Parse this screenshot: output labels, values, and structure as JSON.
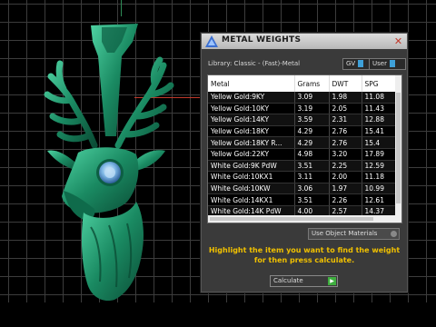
{
  "panel": {
    "title": "METAL WEIGHTS",
    "library_label": "Library: Classic - (Fast)-Metal",
    "gv_label": "GV",
    "user_label": "User",
    "close_icon": "close-icon"
  },
  "table": {
    "headers": [
      "Metal",
      "Grams",
      "DWT",
      "SPG"
    ],
    "rows": [
      [
        "Yellow Gold:9KY",
        "3.09",
        "1.98",
        "11.08"
      ],
      [
        "Yellow Gold:10KY",
        "3.19",
        "2.05",
        "11.43"
      ],
      [
        "Yellow Gold:14KY",
        "3.59",
        "2.31",
        "12.88"
      ],
      [
        "Yellow Gold:18KY",
        "4.29",
        "2.76",
        "15.41"
      ],
      [
        "Yellow Gold:18KY R...",
        "4.29",
        "2.76",
        "15.4"
      ],
      [
        "Yellow Gold:22KY",
        "4.98",
        "3.20",
        "17.89"
      ],
      [
        "White Gold:9K PdW",
        "3.51",
        "2.25",
        "12.59"
      ],
      [
        "White Gold:10KX1",
        "3.11",
        "2.00",
        "11.18"
      ],
      [
        "White Gold:10KW",
        "3.06",
        "1.97",
        "10.99"
      ],
      [
        "White Gold:14KX1",
        "3.51",
        "2.26",
        "12.61"
      ],
      [
        "White Gold:14K PdW",
        "4.00",
        "2.57",
        "14.37"
      ]
    ]
  },
  "use_object_materials": "Use Object Materials",
  "hint_line1": "Highlight the item you want to find the weight",
  "hint_line2": "for then press calculate.",
  "calculate_label": "Calculate",
  "colors": {
    "accent": "#3ea0d8",
    "hint": "#f0c000",
    "model": "#1e8f6a"
  }
}
